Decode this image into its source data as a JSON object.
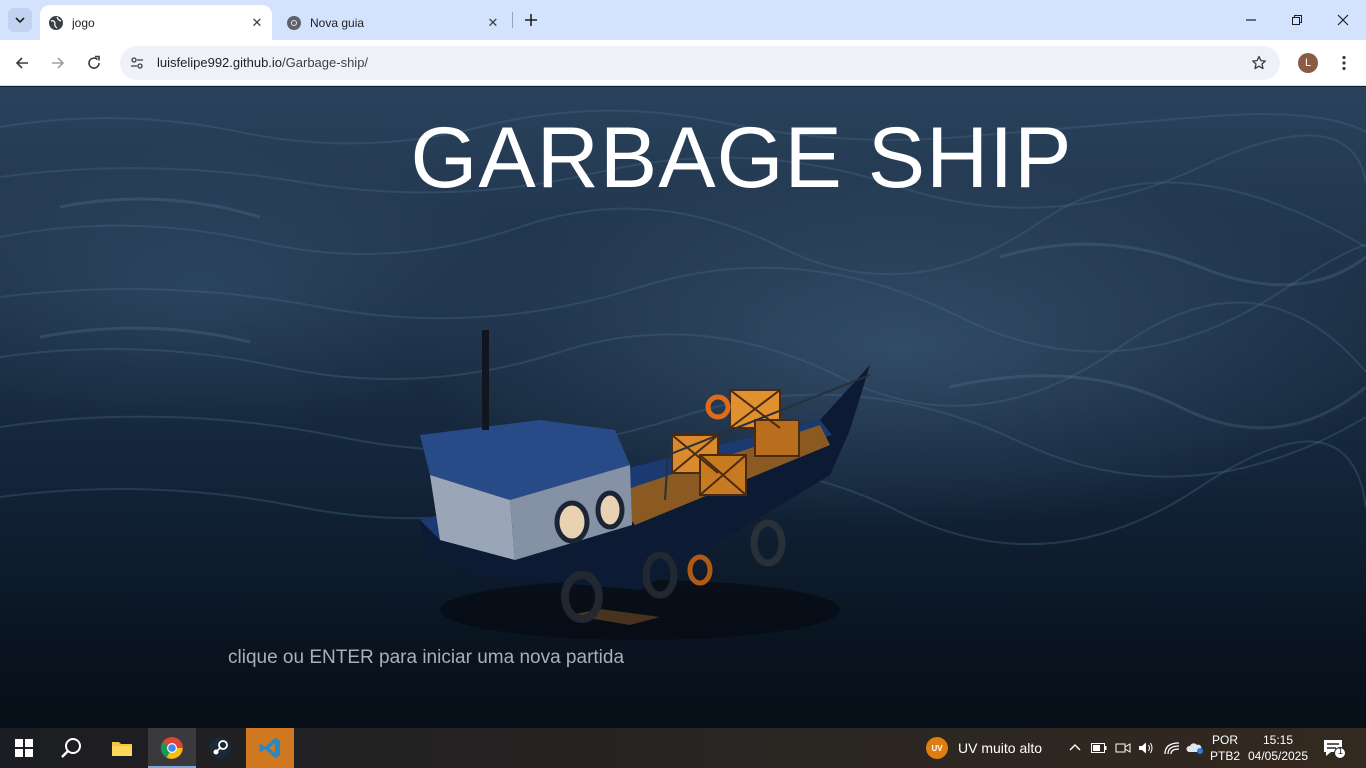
{
  "browser": {
    "tabs": [
      {
        "title": "jogo",
        "active": true
      },
      {
        "title": "Nova guia",
        "active": false
      }
    ],
    "url_host": "luisfelipe992.github.io",
    "url_path": "/Garbage-ship/",
    "profile_initial": "L"
  },
  "game": {
    "title": "GARBAGE SHIP",
    "start_hint": "clique ou ENTER para iniciar uma nova partida"
  },
  "taskbar": {
    "weather_badge": "UV",
    "weather_text": "UV muito alto",
    "language_line1": "POR",
    "language_line2": "PTB2",
    "time": "15:15",
    "date": "04/05/2025",
    "notification_count": "1",
    "apps": [
      "windows-start",
      "search",
      "file-explorer",
      "chrome",
      "steam",
      "vscode"
    ]
  },
  "colors": {
    "tabstrip": "#d3e3fd",
    "ocean_dark": "#0a1522",
    "title_text": "#ffffff",
    "hint_text": "#a9b0b7",
    "vscode_highlight": "#d07820"
  }
}
